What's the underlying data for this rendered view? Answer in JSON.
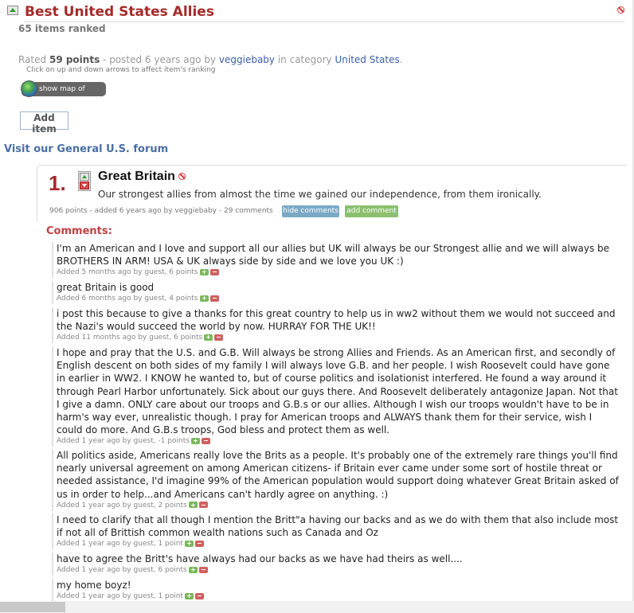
{
  "header": {
    "title": "Best United States Allies",
    "items_ranked": "65 items ranked"
  },
  "meta": {
    "rated": "Rated",
    "points": "59 points",
    "posted": "- posted 6 years ago by",
    "author": "veggiebaby",
    "in_category": "in category",
    "category": "United States",
    "period": "."
  },
  "hint": "Click on up and down arrows to affect item's ranking",
  "map_button": "show map of votes",
  "add_item": "Add item",
  "forum_link": "Visit our General U.S. forum",
  "item": {
    "rank": "1.",
    "name": "Great Britain",
    "description": "Our strongest allies from almost the time we gained our independence, from them ironically.",
    "meta": "906 points - added 6 years ago by veggiebaby - 29 comments",
    "hide_comments": "hide comments",
    "add_comment": "add comment"
  },
  "comments_heading": "Comments:",
  "comments": [
    {
      "text": "I'm an American and I love and support all our allies but UK will always be our Strongest allie and we will always be BROTHERS IN ARM! USA & UK always side by side and we love you UK :)",
      "meta": "Added 5 months ago by guest, 6 points"
    },
    {
      "text": "great Britain is good",
      "meta": "Added 6 months ago by guest, 4 points"
    },
    {
      "text": "i post this because to give a thanks for this great country to help us in ww2 without them we would not succeed and the Nazi's would succeed the world by now. HURRAY FOR THE UK!!",
      "meta": "Added 11 months ago by guest, 6 points"
    },
    {
      "text": "I hope and pray that the U.S. and G.B. Will always be strong Allies and Friends. As an American first, and secondly of English descent on both sides of my family I will always love G.B. and her people. I wish Roosevelt could have gone in earlier in WW2. I KNOW he wanted to, but of course politics and isolationist interfered. He found a way around it through Pearl Harbor unfortunately. Sick about our guys there. And Roosevelt deliberately antagonize Japan. Not that I give a damn. ONLY care about our troops and G.B.s or our allies. Although I wish our troops wouldn't have to be in harm's way ever, unrealistic though. I pray for American troops and ALWAYS thank them for their service, wish I could do more. And G.B.s troops, God bless and protect them as well.",
      "meta": "Added 1 year ago by guest, -1 points"
    },
    {
      "text": "All politics aside, Americans really love the Brits as a people. It's probably one of the extremely rare things you'll find nearly universal agreement on among American citizens- if Britain ever came under some sort of hostile threat or needed assistance, I'd imagine 99% of the American population would support doing whatever Great Britain asked of us in order to help...and Americans can't hardly agree on anything. :)",
      "meta": "Added 1 year ago by guest, 2 points"
    },
    {
      "text": "I need to clarify that all though I mention the Britt\"a having our backs and as we do with them that also include most if not all of Brittish common wealth nations such as Canada and Oz",
      "meta": "Added 1 year ago by guest, 1 point"
    },
    {
      "text": "have to agree the Britt's have always had our backs as we have had theirs as well....",
      "meta": "Added 1 year ago by guest, 6 points"
    },
    {
      "text": "my home boyz!",
      "meta": "Added 1 year ago by guest, 1 point"
    }
  ]
}
